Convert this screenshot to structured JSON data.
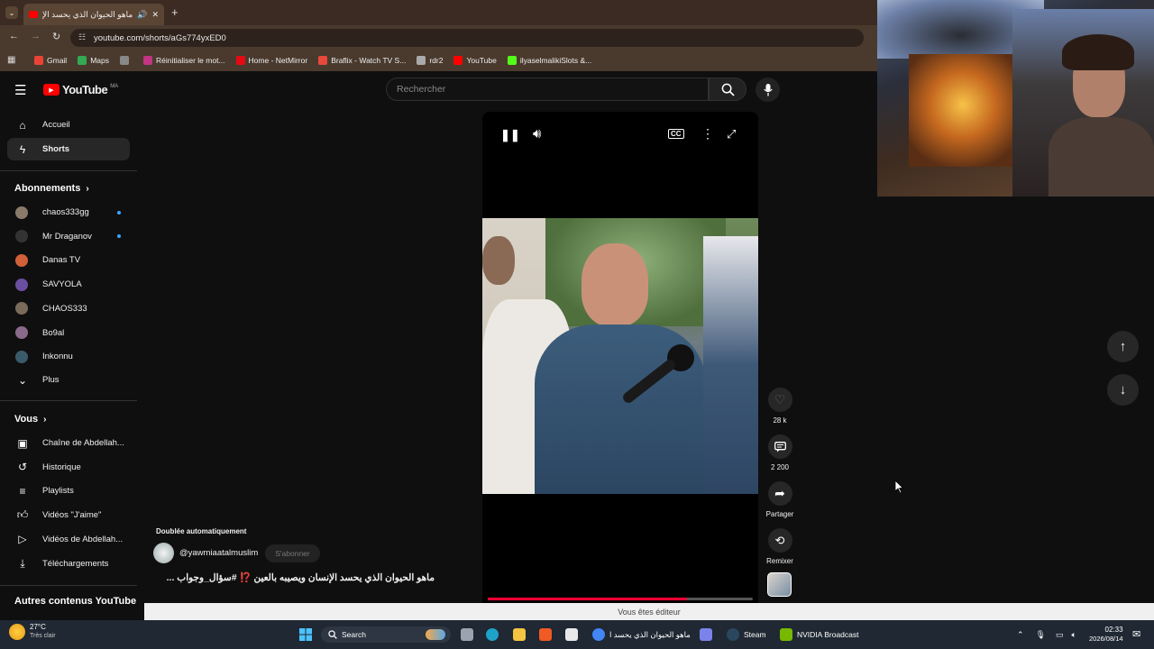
{
  "browser": {
    "tab_title": "ماهو الحيوان الذي يحسد الإن...",
    "url": "youtube.com/shorts/aGs774yxED0",
    "bookmarks": [
      {
        "label": "Gmail",
        "color": "#ea4335"
      },
      {
        "label": "Maps",
        "color": "#34a853"
      },
      {
        "label": "",
        "color": "#888888"
      },
      {
        "label": "Réinitialiser le mot...",
        "color": "#c13584"
      },
      {
        "label": "Home - NetMirror",
        "color": "#e50914"
      },
      {
        "label": "Braflix - Watch TV S...",
        "color": "#e8493c"
      },
      {
        "label": "rdr2",
        "color": "#aaaaaa"
      },
      {
        "label": "YouTube",
        "color": "#ff0000"
      },
      {
        "label": "ilyaselmalikiSlots &...",
        "color": "#53fc18"
      }
    ]
  },
  "header": {
    "logo_text": "YouTube",
    "logo_region": "MA",
    "search_placeholder": "Rechercher"
  },
  "sidebar": {
    "main": [
      {
        "label": "Accueil",
        "icon": "home-icon"
      },
      {
        "label": "Shorts",
        "icon": "shorts-icon",
        "active": true
      }
    ],
    "subscriptions_heading": "Abonnements",
    "subscriptions": [
      {
        "label": "chaos333gg",
        "color": "#8a7a6a",
        "new": true
      },
      {
        "label": "Mr Draganov",
        "color": "#333333",
        "new": true
      },
      {
        "label": "Danas TV",
        "color": "#d0603a",
        "new": false
      },
      {
        "label": "SAVYOLA",
        "color": "#6a4fa0",
        "new": false
      },
      {
        "label": "CHAOS333",
        "color": "#7a6a5a",
        "new": false
      },
      {
        "label": "Bo9al",
        "color": "#8a6a8a",
        "new": false
      },
      {
        "label": "Inkonnu",
        "color": "#3a5a6a",
        "new": false
      }
    ],
    "more_label": "Plus",
    "you_heading": "Vous",
    "you": [
      {
        "label": "Chaîne de Abdellah...",
        "icon": "channel-icon"
      },
      {
        "label": "Historique",
        "icon": "history-icon"
      },
      {
        "label": "Playlists",
        "icon": "playlists-icon"
      },
      {
        "label": "Vidéos \"J'aime\"",
        "icon": "like-icon"
      },
      {
        "label": "Vidéos de Abdellah...",
        "icon": "videos-icon"
      },
      {
        "label": "Téléchargements",
        "icon": "download-icon"
      }
    ],
    "other_heading": "Autres contenus YouTube"
  },
  "short": {
    "dubbed_label": "Doublée automatiquement",
    "channel": "@yawmiaatalmuslim",
    "subscribe_label": "S'abonner",
    "title": "ماهو الحيوان الذي يحسد الإنسان ويصيبه بالعين ⁉️ #سؤال_وجواب ...",
    "likes": "28 k",
    "comments": "2 200",
    "share_label": "Partager",
    "remix_label": "Remixer",
    "progress": 0.75
  },
  "banner_text": "Vous êtes éditeur",
  "taskbar": {
    "weather_temp": "27°C",
    "weather_desc": "Très clair",
    "search_label": "Search",
    "apps": [
      {
        "label": "ماهو الحيوان الذي يحسد ا",
        "color": "#4285f4"
      },
      {
        "label": "Steam",
        "color": "#1b2838"
      },
      {
        "label": "NVIDIA Broadcast",
        "color": "#76b900"
      }
    ],
    "time": "02:33",
    "date": "2026/08/14"
  }
}
